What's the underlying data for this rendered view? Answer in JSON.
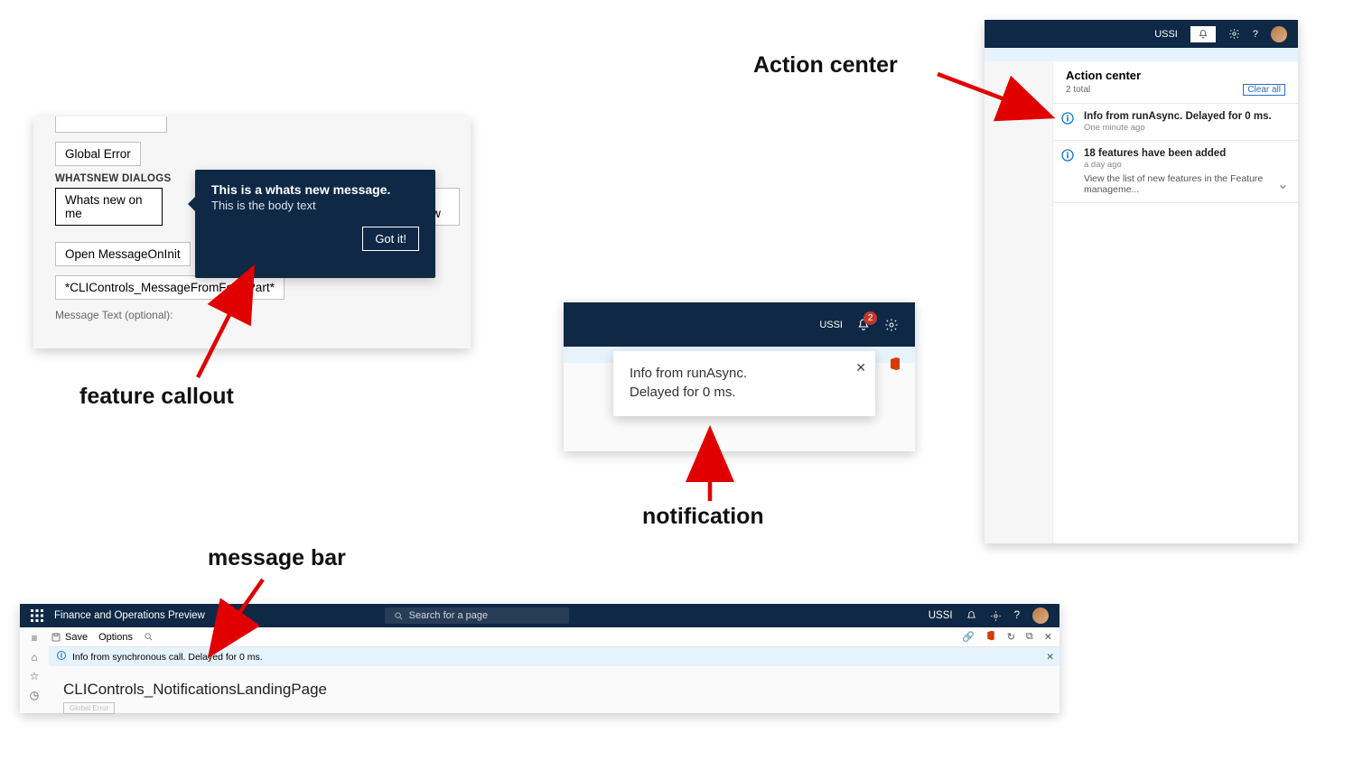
{
  "labels": {
    "feature_callout": "feature callout",
    "notification": "notification",
    "action_center": "Action center",
    "message_bar": "message bar"
  },
  "feature_callout": {
    "section_title": "WHATSNEW DIALOGS",
    "buttons": {
      "global_error": "Global Error",
      "whats_new_on_me": "Whats new on me",
      "whats_new_cropped": "ts new",
      "open_msg_oninit": "Open MessageOnInit",
      "cli_controls_from_formpart": "*CLIControls_MessageFromFormPart*"
    },
    "optional_label": "Message Text (optional):",
    "callout_title": "This is a whats new message.",
    "callout_body": "This is the body text",
    "callout_button": "Got it!"
  },
  "notification": {
    "company": "USSI",
    "badge_count": "2",
    "toast_line1": "Info from runAsync.",
    "toast_line2": "Delayed for 0 ms."
  },
  "action_center": {
    "company": "USSI",
    "panel_title": "Action center",
    "total_text": "2 total",
    "clear_all": "Clear all",
    "items": [
      {
        "title": "Info from runAsync. Delayed for 0 ms.",
        "time": "One minute ago",
        "desc": ""
      },
      {
        "title": "18 features have been added",
        "time": "a day ago",
        "desc": "View the list of new features in the Feature manageme..."
      }
    ]
  },
  "message_bar": {
    "app_title": "Finance and Operations Preview",
    "search_placeholder": "Search for a page",
    "company": "USSI",
    "toolbar_save": "Save",
    "toolbar_options": "Options",
    "ghost_button": "Global Error",
    "bar_text": "Info from synchronous call. Delayed for 0 ms.",
    "page_title": "CLIControls_NotificationsLandingPage"
  }
}
